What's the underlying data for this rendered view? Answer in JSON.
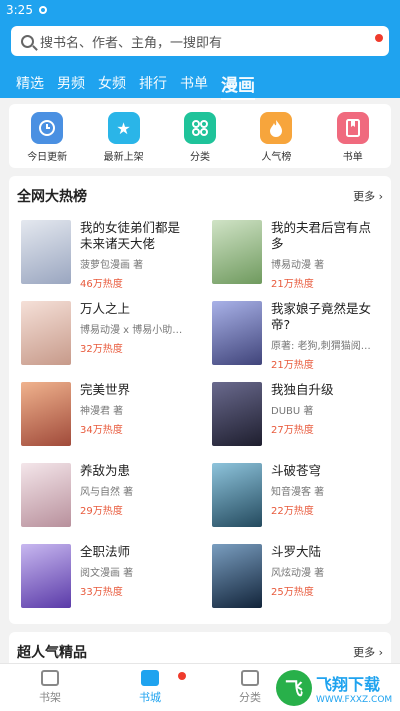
{
  "status": {
    "time": "3:25"
  },
  "search": {
    "placeholder": "搜书名、作者、主角，一搜即有"
  },
  "tabs": [
    "精选",
    "男频",
    "女频",
    "排行",
    "书单",
    "漫画"
  ],
  "shortcuts": [
    {
      "label": "今日更新",
      "icon": "clock-icon",
      "color": "#4a90e2"
    },
    {
      "label": "最新上架",
      "icon": "star-box-icon",
      "color": "#2ab5e8"
    },
    {
      "label": "分类",
      "icon": "grid-icon",
      "color": "#1fc39a"
    },
    {
      "label": "人气榜",
      "icon": "fire-icon",
      "color": "#f7a53c"
    },
    {
      "label": "书单",
      "icon": "book-icon",
      "color": "#f06a7e"
    }
  ],
  "section1": {
    "title": "全网大热榜",
    "more": "更多",
    "books": [
      {
        "title": "我的女徒弟们都是未来诸天大佬",
        "author": "菠萝包漫画 著",
        "heat": "46万热度",
        "cover": "#c9d2e0"
      },
      {
        "title": "我的夫君后宫有点多",
        "author": "博易动漫 著",
        "heat": "21万热度",
        "cover": "#a8c79a"
      },
      {
        "title": "万人之上",
        "author": "博易动漫 x 博易小助手...",
        "heat": "32万热度",
        "cover": "#e8c6b8"
      },
      {
        "title": "我家娘子竟然是女帝?",
        "author": "原著: 老狗,刺猬猫阅读,...",
        "heat": "21万热度",
        "cover": "#7a7fb8"
      },
      {
        "title": "完美世界",
        "author": "神漫君 著",
        "heat": "34万热度",
        "cover": "#d98a6a"
      },
      {
        "title": "我独自升级",
        "author": "DUBU 著",
        "heat": "27万热度",
        "cover": "#4b4a66"
      },
      {
        "title": "养敌为患",
        "author": "风与自然 著",
        "heat": "29万热度",
        "cover": "#d8c0c8"
      },
      {
        "title": "斗破苍穹",
        "author": "知音漫客 著",
        "heat": "22万热度",
        "cover": "#3a7a9a"
      },
      {
        "title": "全职法师",
        "author": "阅文漫画 著",
        "heat": "33万热度",
        "cover": "#8e7ad6"
      },
      {
        "title": "斗罗大陆",
        "author": "风炫动漫 著",
        "heat": "25万热度",
        "cover": "#2e4a6a"
      }
    ]
  },
  "section2": {
    "title": "超人气精品",
    "more": "更多"
  },
  "bottomnav": [
    {
      "label": "书架",
      "icon": "bookshelf-icon"
    },
    {
      "label": "书城",
      "icon": "home-icon"
    },
    {
      "label": "分类",
      "icon": "grid-icon"
    }
  ],
  "watermark": {
    "big": "飞翔下载",
    "small": "WWW.FXXZ.COM"
  }
}
